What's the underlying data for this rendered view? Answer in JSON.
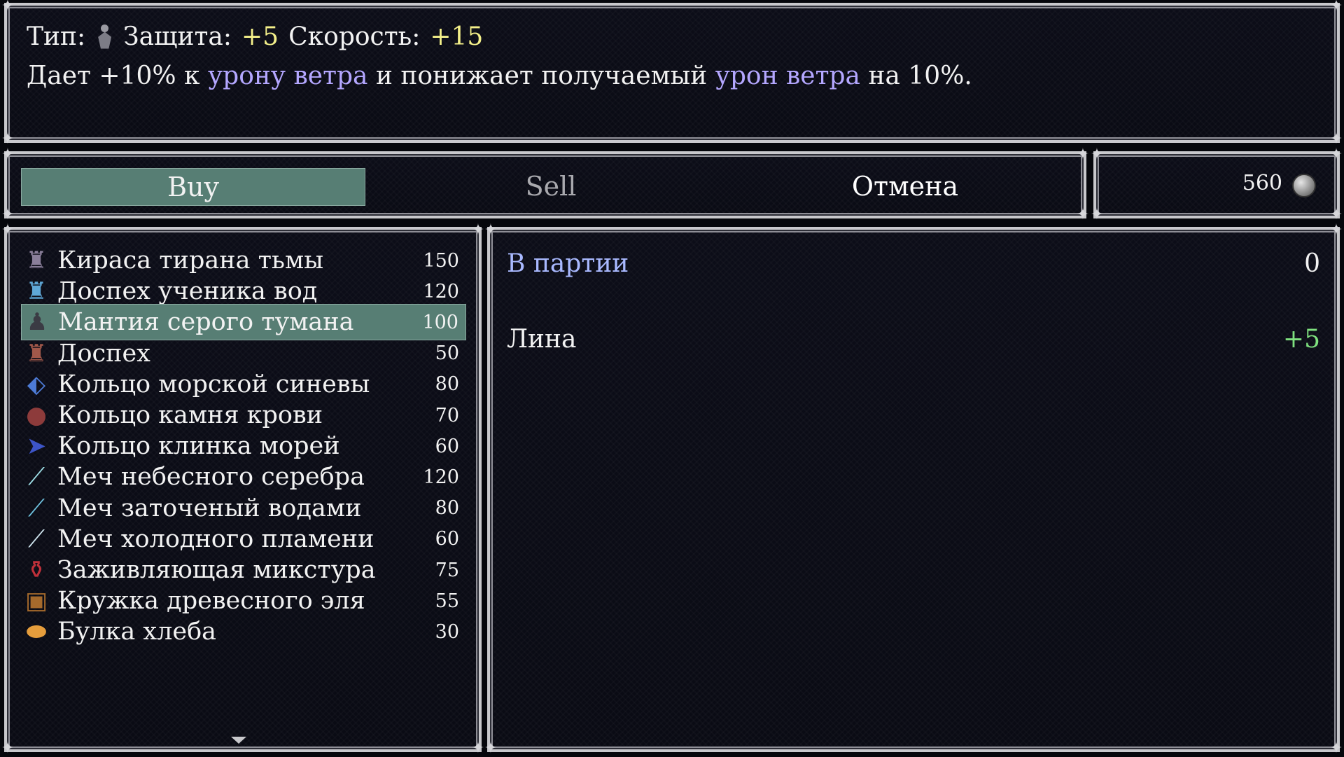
{
  "help": {
    "type_label": "Тип:",
    "defense_label": "Защита:",
    "defense_value": "+5",
    "speed_label": "Скорость:",
    "speed_value": "+15",
    "desc_part1": "Дает +10% к",
    "desc_highlight1": "урону ветра",
    "desc_part2": "и понижает получаемый",
    "desc_highlight2": "урон ветра",
    "desc_part3": "на 10%."
  },
  "commands": {
    "buy": "Buy",
    "sell": "Sell",
    "cancel": "Отмена",
    "selected": "Buy"
  },
  "gold": {
    "value": "560"
  },
  "items": [
    {
      "name": "Кираса тирана тьмы",
      "price": "150",
      "icon": "dark-armor-icon"
    },
    {
      "name": "Доспех ученика вод",
      "price": "120",
      "icon": "blue-armor-icon"
    },
    {
      "name": "Мантия серого тумана",
      "price": "100",
      "icon": "robe-icon",
      "selected": true
    },
    {
      "name": "Доспех",
      "price": "50",
      "icon": "leather-armor-icon"
    },
    {
      "name": "Кольцо морской синевы",
      "price": "80",
      "icon": "blue-ring-icon"
    },
    {
      "name": "Кольцо камня крови",
      "price": "70",
      "icon": "red-ring-icon"
    },
    {
      "name": "Кольцо клинка морей",
      "price": "60",
      "icon": "blade-ring-icon"
    },
    {
      "name": "Меч небесного серебра",
      "price": "120",
      "icon": "silver-sword-icon"
    },
    {
      "name": "Меч заточеный водами",
      "price": "80",
      "icon": "water-sword-icon"
    },
    {
      "name": "Меч холодного пламени",
      "price": "60",
      "icon": "frost-sword-icon"
    },
    {
      "name": "Заживляющая микстура",
      "price": "75",
      "icon": "potion-icon"
    },
    {
      "name": "Кружка древесного эля",
      "price": "55",
      "icon": "ale-mug-icon"
    },
    {
      "name": "Булка хлеба",
      "price": "30",
      "icon": "bread-icon"
    }
  ],
  "status": {
    "party_label": "В партии",
    "party_count": "0",
    "member_name": "Лина",
    "member_diff": "+5"
  },
  "colors": {
    "highlight": "#577e74",
    "keyword": "#b4a7ff",
    "stat_value": "#f4f08a",
    "increase": "#7fe17f",
    "party_label": "#a9b9ff"
  }
}
